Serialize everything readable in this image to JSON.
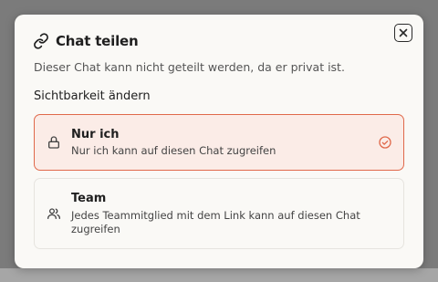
{
  "dialog": {
    "title": "Chat teilen",
    "description": "Dieser Chat kann nicht geteilt werden, da er privat ist.",
    "section_title": "Sichtbarkeit ändern",
    "icons": {
      "title": "link-icon",
      "close": "close-icon"
    },
    "options": [
      {
        "title": "Nur ich",
        "description": "Nur ich kann auf diesen Chat zugreifen",
        "icon": "lock-icon",
        "selected": true
      },
      {
        "title": "Team",
        "description": "Jedes Teammitglied mit dem Link kann auf diesen Chat zugreifen",
        "icon": "users-icon",
        "selected": false
      }
    ]
  },
  "colors": {
    "accent": "#e0694b",
    "selected_bg": "#fbece7",
    "dialog_bg": "#faf9f6",
    "overlay": "#7b7b7b"
  }
}
